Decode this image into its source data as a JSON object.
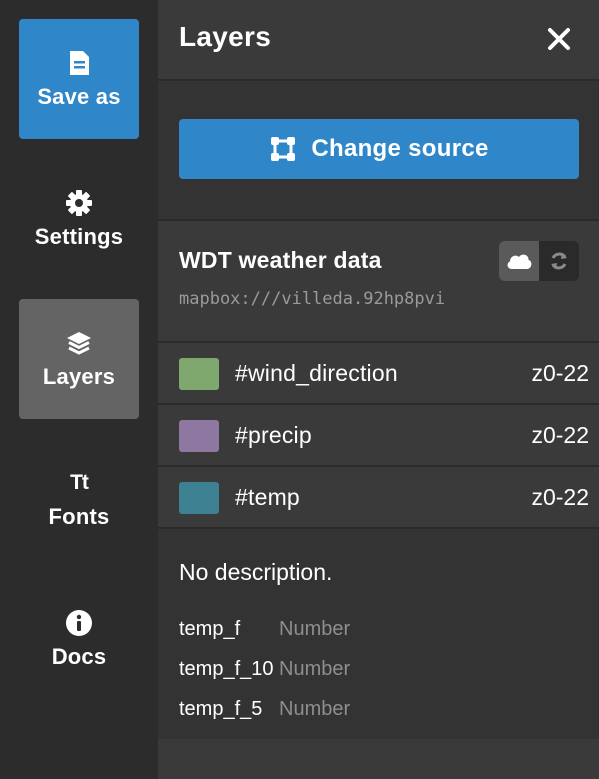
{
  "nav": {
    "save_as": "Save as",
    "settings": "Settings",
    "layers": "Layers",
    "fonts_glyph": "Tt",
    "fonts": "Fonts",
    "docs": "Docs"
  },
  "panel": {
    "title": "Layers",
    "change_source": "Change source"
  },
  "dataset": {
    "name": "WDT weather data",
    "url": "mapbox:///villeda.92hp8pvi"
  },
  "layers": [
    {
      "name": "#wind_direction",
      "zoom": "z0-22",
      "color": "#7fa86f"
    },
    {
      "name": "#precip",
      "zoom": "z0-22",
      "color": "#8e77a0"
    },
    {
      "name": "#temp",
      "zoom": "z0-22",
      "color": "#3d8192"
    }
  ],
  "description": "No description.",
  "fields": [
    {
      "name": "temp_f",
      "type": "Number"
    },
    {
      "name": "temp_f_10",
      "type": "Number"
    },
    {
      "name": "temp_f_5",
      "type": "Number"
    }
  ],
  "colors": {
    "accent": "#2f86c8",
    "rail_bg": "#2c2c2c",
    "panel_bg": "#3a3a3a",
    "active_nav": "#646464"
  },
  "icons": {
    "save": "save-icon",
    "settings": "gear-icon",
    "layers": "layers-icon",
    "docs": "info-icon",
    "close": "close-icon",
    "change_source": "source-frame-icon",
    "cloud": "cloud-icon",
    "refresh": "refresh-icon"
  }
}
